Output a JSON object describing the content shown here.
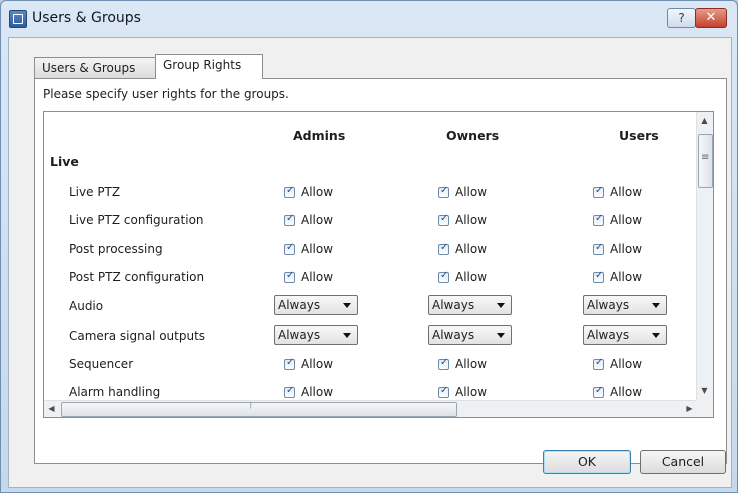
{
  "window": {
    "title": "Users & Groups",
    "help_label": "?",
    "close_label": "✕"
  },
  "tabs": [
    {
      "label": "Users & Groups",
      "active": false
    },
    {
      "label": "Group Rights",
      "active": true
    }
  ],
  "instructions": "Please specify user rights for the groups.",
  "grid": {
    "columns": [
      "Admins",
      "Owners",
      "Users"
    ],
    "section": "Live",
    "rows": [
      {
        "label": "Live PTZ",
        "type": "checkbox",
        "value": "Allow"
      },
      {
        "label": "Live PTZ configuration",
        "type": "checkbox",
        "value": "Allow"
      },
      {
        "label": "Post processing",
        "type": "checkbox",
        "value": "Allow"
      },
      {
        "label": "Post PTZ configuration",
        "type": "checkbox",
        "value": "Allow"
      },
      {
        "label": "Audio",
        "type": "select",
        "value": "Always"
      },
      {
        "label": "Camera signal outputs",
        "type": "select",
        "value": "Always"
      },
      {
        "label": "Sequencer",
        "type": "checkbox",
        "value": "Allow"
      },
      {
        "label": "Alarm handling",
        "type": "checkbox",
        "value": "Allow"
      }
    ]
  },
  "buttons": {
    "ok": "OK",
    "cancel": "Cancel"
  },
  "colors": {
    "titlebar": "#c6d8ec",
    "close": "#c3422b",
    "default_button_border": "#3c7fb1"
  }
}
